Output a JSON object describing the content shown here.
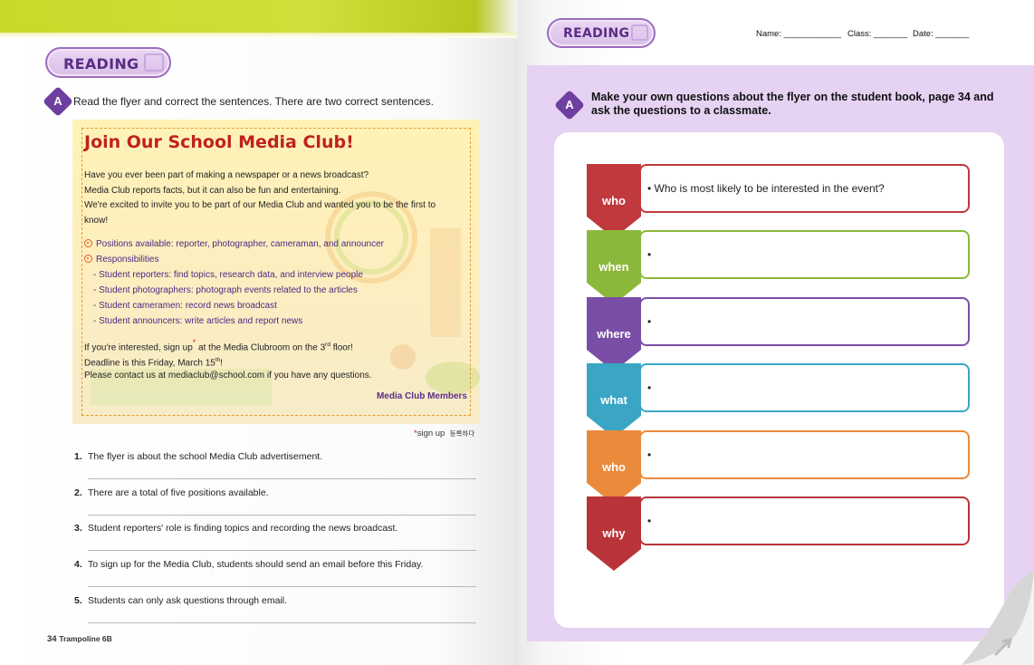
{
  "left_page": {
    "reading_label": "READING",
    "activity_letter": "A",
    "instruction": "Read the flyer and correct the sentences. There are two correct sentences.",
    "flyer": {
      "title": "Join Our School Media Club!",
      "intro_lines": [
        "Have you ever been part of making a newspaper or a news broadcast?",
        "Media Club reports facts, but it can also be fun and entertaining.",
        "We're excited to invite you to be part of our Media Club and wanted you to be the first to",
        "know!"
      ],
      "positions": "Positions available: reporter, photographer, cameraman, and announcer",
      "responsibilities_heading": "Responsibilities",
      "responsibilities": [
        "- Student reporters: find topics, research data, and interview people",
        "- Student photographers: photograph events related to the articles",
        "- Student cameramen: record news broadcast",
        "- Student announcers: write articles and report news"
      ],
      "signup_line_a": "If you're interested, sign up",
      "signup_line_b": " at the Media Clubroom on the 3",
      "signup_line_sup": "rd",
      "signup_line_c": " floor!",
      "deadline_a": "Deadline is this Friday, March 15",
      "deadline_sup": "th",
      "deadline_b": "!",
      "contact": "Please contact us at mediaclub@school.com if you have any questions.",
      "signature": "Media Club Members"
    },
    "footnote_mark": "*",
    "footnote_term": "sign up",
    "footnote_gloss": "등록하다",
    "questions": [
      {
        "num": "1.",
        "text": "The flyer is about the school Media Club advertisement."
      },
      {
        "num": "2.",
        "text": "There are a total of five positions available."
      },
      {
        "num": "3.",
        "text": "Student reporters' role is finding topics and recording the news broadcast."
      },
      {
        "num": "4.",
        "text": "To sign up for the Media Club, students should send an email before this Friday."
      },
      {
        "num": "5.",
        "text": "Students can only ask questions through email."
      }
    ],
    "page_number": "34",
    "book_title": "Trampoline 6B"
  },
  "right_page": {
    "reading_label": "READING",
    "name_label": "Name: ____________",
    "class_label": "Class: _______",
    "date_label": "Date: _______",
    "activity_letter": "A",
    "instruction": "Make your own questions about the flyer on the student book, page 34 and ask the questions to a classmate.",
    "rows": [
      {
        "word": "who",
        "text": "• Who is most likely to be interested in the event?",
        "color": "#c0393c"
      },
      {
        "word": "when",
        "text": "•",
        "color": "#8bb83a"
      },
      {
        "word": "where",
        "text": "•",
        "color": "#7a4ea6"
      },
      {
        "word": "what",
        "text": "•",
        "color": "#3aa6c4"
      },
      {
        "word": "who",
        "text": "•",
        "color": "#ea8a3a"
      },
      {
        "word": "why",
        "text": "•",
        "color": "#b83438"
      }
    ]
  },
  "colors": {
    "top_band": "#c9d92a",
    "purple_panel": "#e6d2f3",
    "flyer_bg": "#fff2b6",
    "flyer_title": "#c0211f",
    "accent_purple": "#5b2d86"
  }
}
